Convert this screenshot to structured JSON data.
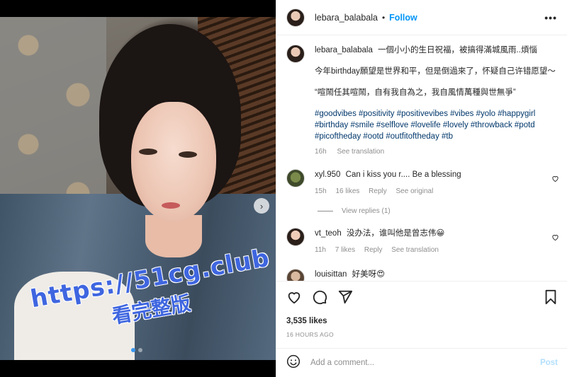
{
  "post": {
    "username": "lebara_balabala",
    "follow_label": "Follow",
    "header_separator": "•",
    "more_label": "•••",
    "carousel_next": "›"
  },
  "watermark": {
    "line1": "https://51cg.club",
    "line2": "看完整版"
  },
  "caption": {
    "username": "lebara_balabala",
    "line1": "一個小小的生日祝福，被搞得滿城風雨..煩惱",
    "line2": "今年birthday願望是世界和平，但是倒過來了，怀疑自己许错愿望～",
    "line3": "“喧鬧任其喧鬧，自有我自為之，我自風情萬種與世無爭”",
    "hashtags": "#goodvibes #positivity #positivevibes #vibes #yolo #happygirl #birthday #smile #selflove #lovelife #lovely #throwback #potd #picoftheday #ootd #outfitoftheday #tb",
    "time": "16h",
    "see_translation": "See translation"
  },
  "comments": [
    {
      "username": "xyl.950",
      "text": "Can i kiss you r.... Be a blessing",
      "time": "15h",
      "likes": "16 likes",
      "reply": "Reply",
      "extra": "See original",
      "view_replies": "View replies (1)"
    },
    {
      "username": "vt_teoh",
      "text": "没办法，谁叫他是曾志伟😀",
      "time": "11h",
      "likes": "7 likes",
      "reply": "Reply",
      "extra": "See translation"
    },
    {
      "username": "louisittan",
      "text": "好美呀😍"
    }
  ],
  "actions": {
    "likes": "3,535 likes",
    "time_ago": "16 HOURS AGO"
  },
  "composer": {
    "placeholder": "Add a comment...",
    "post_label": "Post"
  },
  "icons": [
    "heart-icon",
    "comment-icon",
    "share-icon",
    "bookmark-icon",
    "emoji-icon",
    "more-icon",
    "chevron-right-icon"
  ],
  "colors": {
    "link": "#0095f6",
    "hashtag": "#00376b",
    "muted": "#8e8e8e",
    "watermark": "#3f66e0"
  }
}
